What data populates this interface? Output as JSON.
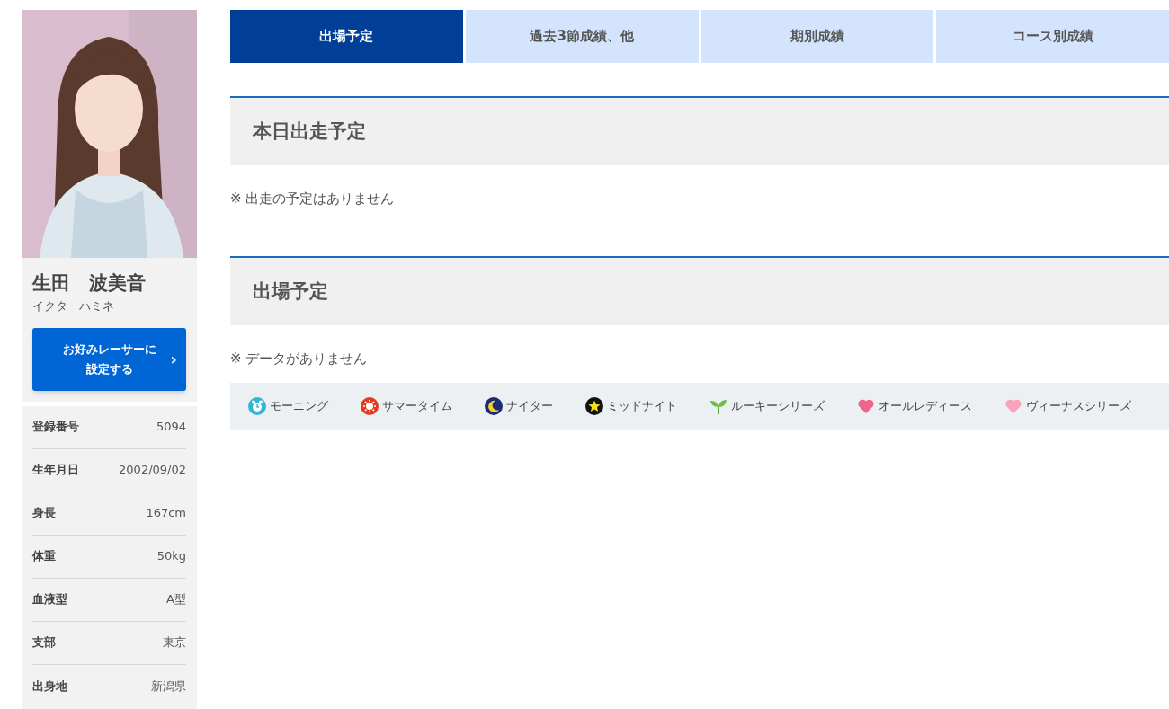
{
  "profile": {
    "name": "生田　波美音",
    "kana": "イクタ　ハミネ",
    "favorite_button": {
      "line_1": "お好みレーサーに",
      "line_2": "設定する",
      "chevron": "›"
    },
    "details": [
      {
        "label": "登録番号",
        "value": "5094"
      },
      {
        "label": "生年月日",
        "value": "2002/09/02"
      },
      {
        "label": "身長",
        "value": "167cm"
      },
      {
        "label": "体重",
        "value": "50kg"
      },
      {
        "label": "血液型",
        "value": "A型"
      },
      {
        "label": "支部",
        "value": "東京"
      },
      {
        "label": "出身地",
        "value": "新潟県"
      }
    ]
  },
  "tabs": [
    {
      "label": "出場予定",
      "selected": true
    },
    {
      "label": "過去3節成績、他",
      "selected": false
    },
    {
      "label": "期別成績",
      "selected": false
    },
    {
      "label": "コース別成績",
      "selected": false
    }
  ],
  "sections": [
    {
      "title": "本日出走予定",
      "note": "※ 出走の予定はありません"
    },
    {
      "title": "出場予定",
      "note": "※ データがありません"
    }
  ],
  "legend": [
    {
      "kind": "morning",
      "label": "モーニング"
    },
    {
      "kind": "summer",
      "label": "サマータイム"
    },
    {
      "kind": "nighter",
      "label": "ナイター"
    },
    {
      "kind": "midnight",
      "label": "ミッドナイト"
    },
    {
      "kind": "rookie",
      "label": "ルーキーシリーズ"
    },
    {
      "kind": "ladies",
      "label": "オールレディース"
    },
    {
      "kind": "venus",
      "label": "ヴィーナスシリーズ"
    }
  ]
}
